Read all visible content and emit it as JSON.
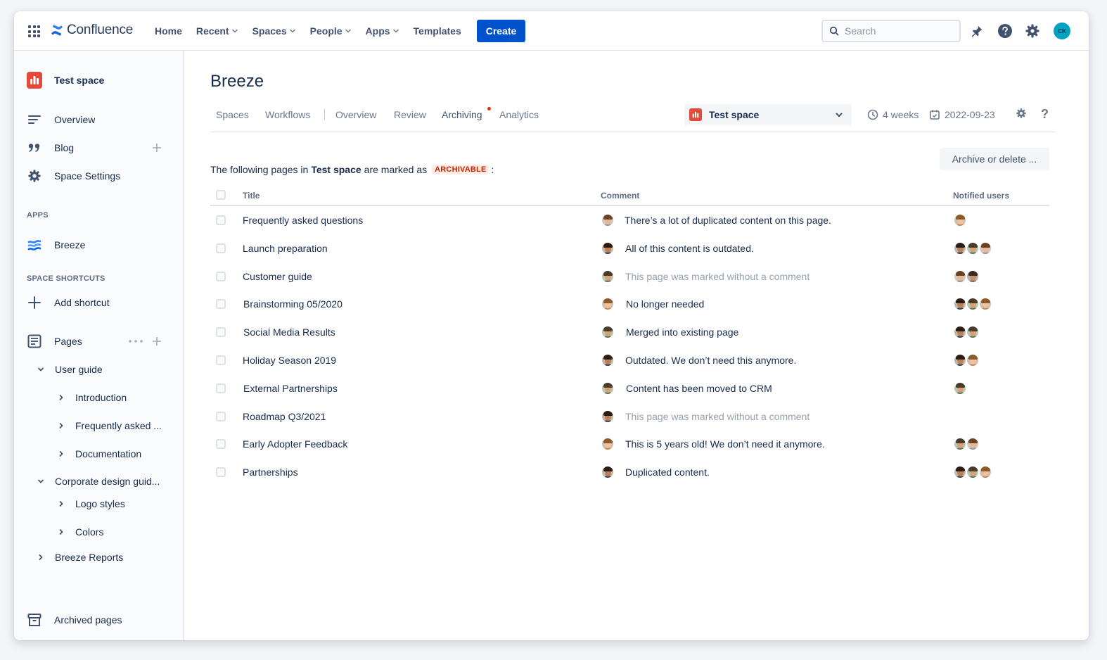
{
  "topbar": {
    "app_name": "Confluence",
    "nav": [
      "Home",
      "Recent",
      "Spaces",
      "People",
      "Apps",
      "Templates"
    ],
    "nav_dropdown": [
      false,
      true,
      true,
      true,
      true,
      false
    ],
    "create_label": "Create",
    "search_placeholder": "Search",
    "avatar_initials": "CK",
    "icons": [
      "app-switcher-icon",
      "notifications-icon",
      "help-icon",
      "settings-icon"
    ]
  },
  "sidebar": {
    "space_name": "Test space",
    "items": [
      {
        "label": "Overview",
        "icon": "overview-icon"
      },
      {
        "label": "Blog",
        "icon": "quote-icon"
      },
      {
        "label": "Space Settings",
        "icon": "gear-icon"
      }
    ],
    "apps_heading": "APPS",
    "app_item": "Breeze",
    "shortcuts_heading": "SPACE SHORTCUTS",
    "add_shortcut": "Add shortcut",
    "pages_label": "Pages",
    "tree": [
      "User guide",
      "Introduction",
      "Frequently asked ...",
      "Documentation",
      "Corporate design guid...",
      "Logo styles",
      "Colors",
      "Breeze Reports"
    ],
    "archived_pages": "Archived pages"
  },
  "main": {
    "title": "Breeze",
    "tabs": [
      "Spaces",
      "Workflows",
      "Overview",
      "Review",
      "Archiving",
      "Analytics"
    ],
    "active_tab": "Archiving",
    "space_select": "Test space",
    "period": "4 weeks",
    "date": "2022-09-23",
    "intro_prefix": "The following pages in",
    "intro_space": "Test space",
    "intro_middle": "are marked as",
    "lozenge": "ARCHIVABLE",
    "intro_suffix": ":",
    "archive_button": "Archive or delete ...",
    "columns": [
      "Title",
      "Comment",
      "Notified users"
    ],
    "rows": [
      {
        "title": "Frequently asked questions",
        "comment": "There’s a lot of duplicated content on this page.",
        "muted": false,
        "users": 1
      },
      {
        "title": "Launch preparation",
        "comment": "All of this content is outdated.",
        "muted": false,
        "users": 3
      },
      {
        "title": "Customer guide",
        "comment": "This page was marked without a comment",
        "muted": true,
        "users": 2
      },
      {
        "title": "Brainstorming 05/2020",
        "comment": "No longer needed",
        "muted": false,
        "users": 3
      },
      {
        "title": "Social Media Results",
        "comment": "Merged into existing page",
        "muted": false,
        "users": 2
      },
      {
        "title": "Holiday Season 2019",
        "comment": "Outdated. We don’t need this anymore.",
        "muted": false,
        "users": 2
      },
      {
        "title": "External Partnerships",
        "comment": "Content has been moved to CRM",
        "muted": false,
        "users": 1
      },
      {
        "title": "Roadmap Q3/2021",
        "comment": "This page was marked without a comment",
        "muted": true,
        "users": 0
      },
      {
        "title": "Early Adopter Feedback",
        "comment": "This is 5 years old! We don’t need it anymore.",
        "muted": false,
        "users": 2
      },
      {
        "title": "Partnerships",
        "comment": "Duplicated content.",
        "muted": false,
        "users": 3
      }
    ]
  },
  "colors": {
    "brand_blue": "#0052cc",
    "space_red": "#e5493a",
    "lozenge_bg": "#ffebe6",
    "lozenge_text": "#bf2600",
    "text": "#172b4d",
    "muted": "#97a0af"
  }
}
